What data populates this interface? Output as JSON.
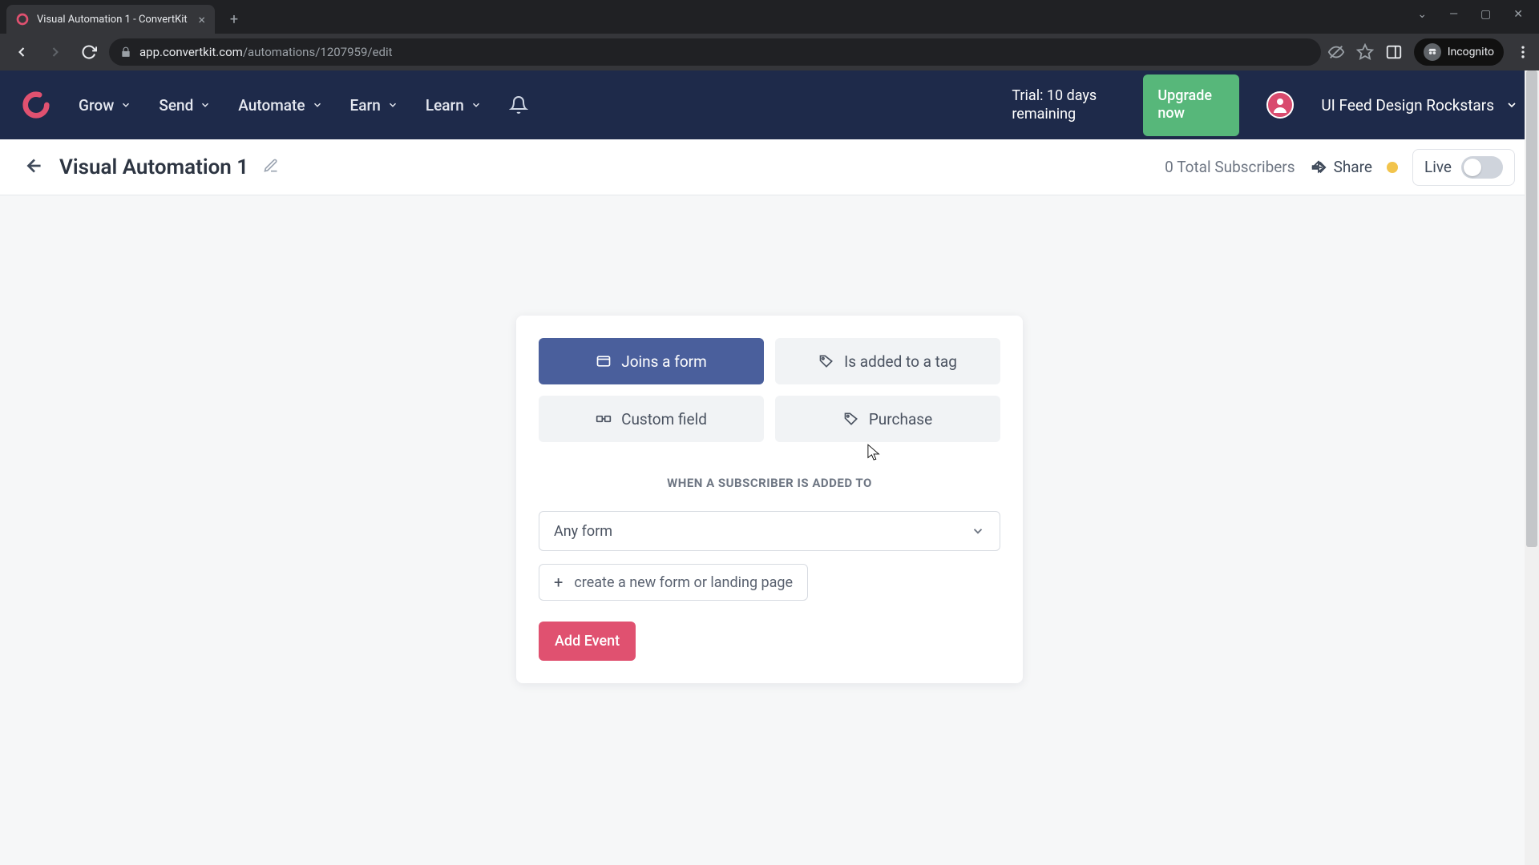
{
  "browser": {
    "tab_title": "Visual Automation 1 - ConvertKit",
    "url_host": "app.convertkit.com",
    "url_path": "/automations/1207959/edit",
    "incognito_label": "Incognito"
  },
  "header": {
    "nav": {
      "grow": "Grow",
      "send": "Send",
      "automate": "Automate",
      "earn": "Earn",
      "learn": "Learn"
    },
    "trial_text": "Trial: 10 days remaining",
    "upgrade_label": "Upgrade now",
    "account_name": "UI Feed Design Rockstars"
  },
  "subheader": {
    "title": "Visual Automation 1",
    "subscribers": "0 Total Subscribers",
    "share_label": "Share",
    "live_label": "Live"
  },
  "panel": {
    "options": {
      "joins_form": "Joins a form",
      "added_tag": "Is added to a tag",
      "custom_field": "Custom field",
      "purchase": "Purchase"
    },
    "section_label": "WHEN A SUBSCRIBER IS ADDED TO",
    "select_value": "Any form",
    "create_link": "create a new form or landing page",
    "add_event": "Add Event"
  }
}
